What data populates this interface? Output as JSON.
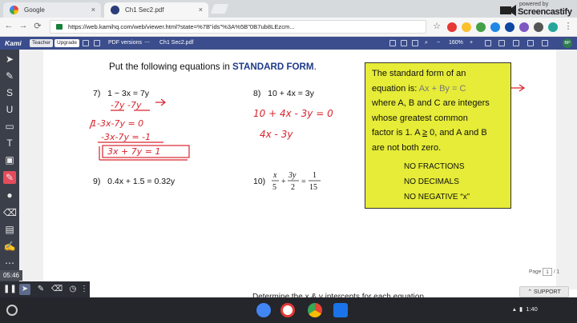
{
  "browser": {
    "tabs": [
      {
        "title": "Google",
        "favicon": "google-icon",
        "close": "×"
      },
      {
        "title": "Ch1 Sec2.pdf",
        "favicon": "kami-icon",
        "close": "×"
      }
    ],
    "url": "https://web.kamihq.com/web/viewer.html?state=%7B\"ids\"%3A%5B\"0B7ub8LEzcm...",
    "watermark": {
      "powered": "powered by",
      "brand": "Screencastify"
    }
  },
  "kami": {
    "logo": "Kami",
    "teacher_badge": "Teacher",
    "upgrade_badge": "Upgrade",
    "pdf_versions": "PDF versions",
    "file": "Ch1 Sec2.pdf",
    "zoom": "160%",
    "avatar": "BP"
  },
  "worksheet": {
    "heading_pre": "Put the following equations in ",
    "heading_bold": "STANDARD FORM",
    "heading_post": ".",
    "problems": {
      "p7": {
        "num": "7)",
        "eq": "1 − 3x = 7y"
      },
      "p8": {
        "num": "8)",
        "eq": "10 + 4x = 3y"
      },
      "p9": {
        "num": "9)",
        "eq": "0.4x + 1.5 = 0.32y"
      },
      "p10": {
        "num": "10)",
        "x": "x",
        "five": "5",
        "plus": "+",
        "threey": "3y",
        "two": "2",
        "eq": "=",
        "one": "1",
        "fifteen": "15"
      }
    },
    "box": {
      "line1": "The standard form of an",
      "line2a": "equation is:     ",
      "form": "Ax + By = C",
      "line3": "where A, B and C are integers",
      "line4": "whose greatest common",
      "line5a": "factor is 1.  A ",
      "ge": "≥",
      "line5b": " 0, and A and B",
      "line6": "are not both zero."
    },
    "list": [
      "NO FRACTIONS",
      "NO DECIMALS",
      "NO NEGATIVE “x”"
    ],
    "cutoff": "Determine the x & y intercepts for each equation"
  },
  "handwriting": {
    "p7_line1": "-7y  -7y",
    "p7_line2": "1-3x-7y = 0",
    "p7_line3": "-3x-7y = -1",
    "p7_line4": "3x + 7y = 1",
    "p8_line1": "10 + 4x - 3y = 0",
    "p8_line2": "4x - 3y"
  },
  "pager": {
    "label": "Page",
    "current": "1",
    "total": "/ 1"
  },
  "clock": "05:46",
  "support": "SUPPORT",
  "tray": {
    "time": "1:40"
  },
  "colors": {
    "ink": "#d8242e",
    "highlight": "#e6ec37",
    "kami_bar": "#3b4d8c"
  }
}
